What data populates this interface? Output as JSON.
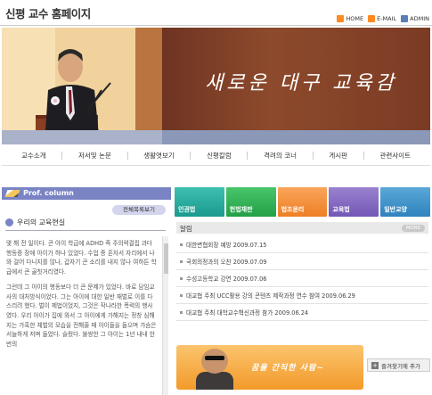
{
  "header": {
    "site_title": "신평 교수 홈페이지",
    "links": [
      {
        "label": "HOME",
        "icon": "home-icon"
      },
      {
        "label": "E-MAIL",
        "icon": "email-icon"
      },
      {
        "label": "ADMIN",
        "icon": "admin-icon"
      }
    ]
  },
  "banner": {
    "slogan": "새로운 대구 교육감"
  },
  "nav": {
    "items": [
      "교수소개",
      "저서및 논문",
      "생활엿보기",
      "신평칼럼",
      "격려의 코너",
      "게시판",
      "관련사이트"
    ]
  },
  "column": {
    "title": "Prof. column",
    "list_button": "전체목록보기",
    "heading": "우리의 교육현실",
    "paragraphs": [
      "몇 해 전 일이다. 큰 아이 학급에 ADHD 즉 주의력결핍 과다행동증 장애 아이가 하나 있었다. 수업 중 혼자서 자리에서 나와 걸어 다니지를 않나, 갑자기 큰 소리를 내지 않나 여하튼 학급에서 큰 골칫거리였다.",
      "그런데 그 아이의 행동보다 더 큰 문제가 있었다. 바로 담임교사의 대처방식이었다. 그는 아이에 대한 일반 재벌로 이를 다스리려 했다. 벌이 제법이었지, 그것은 작나라한 폭력의 행사였다. 우리 아이가 집에 와서 그 아이에게 가해지는 정창 심해지는 가혹한 체벌의 모습을 전해줄 때 아이들을 들으며 가슴은 서늘하게 저며 들었다. 슬펐다. 불쌍한 그 아이는 1년 내내 한 번의"
    ]
  },
  "categories": [
    {
      "label": "인권법"
    },
    {
      "label": "헌법재판"
    },
    {
      "label": "법조윤리"
    },
    {
      "label": "교육법"
    },
    {
      "label": "일반교양"
    }
  ],
  "notices": {
    "title": "알림",
    "more_label": "MORE",
    "items": [
      "대한변협회장 예방 2009.07.15",
      "국회의정과의 오찬 2009.07.09",
      "수성고등학교 강연 2009.07.06",
      "대교협 주최 UCC활용 강의 콘텐츠 제작과정 연수 참여 2009.06.29",
      "대교협 주최 대학교수혁신과정 참가 2009.06.24"
    ]
  },
  "bottom_banner": {
    "text": "꿈을 간직한 사람~"
  },
  "favorites_button": {
    "label": "즐겨찾기에 추가"
  },
  "colors": {
    "banner_brown": "#7b3b24",
    "column_bar": "#7a84c4",
    "accent_orange": "#f39a2a"
  }
}
